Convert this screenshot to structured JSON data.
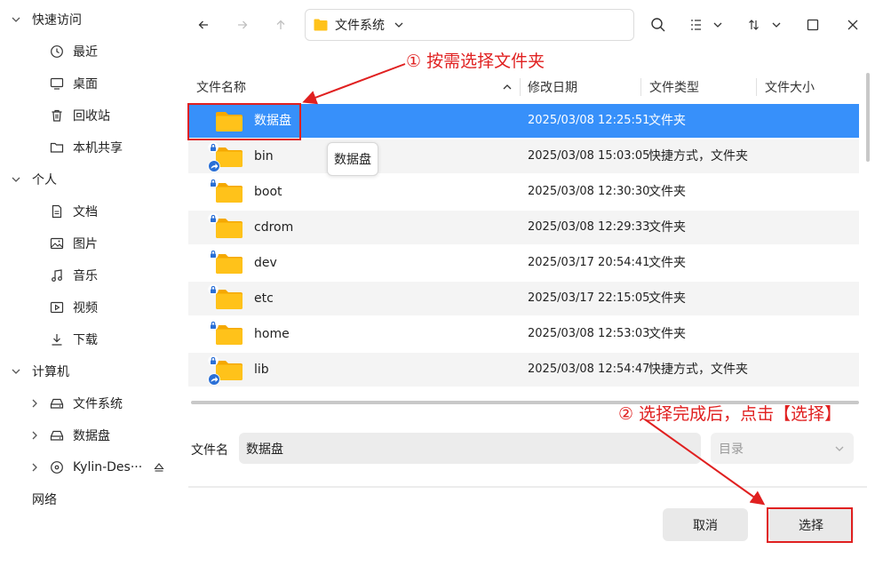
{
  "sidebar": {
    "groups": [
      {
        "label": "快速访问",
        "items": [
          {
            "label": "最近",
            "icon": "clock-icon"
          },
          {
            "label": "桌面",
            "icon": "monitor-icon"
          },
          {
            "label": "回收站",
            "icon": "trash-icon"
          },
          {
            "label": "本机共享",
            "icon": "folder-share-icon"
          }
        ]
      },
      {
        "label": "个人",
        "items": [
          {
            "label": "文档",
            "icon": "document-icon"
          },
          {
            "label": "图片",
            "icon": "picture-icon"
          },
          {
            "label": "音乐",
            "icon": "music-icon"
          },
          {
            "label": "视频",
            "icon": "video-icon"
          },
          {
            "label": "下载",
            "icon": "download-icon"
          }
        ]
      },
      {
        "label": "计算机",
        "items": [
          {
            "label": "文件系统",
            "icon": "drive-icon"
          },
          {
            "label": "数据盘",
            "icon": "drive-icon"
          },
          {
            "label": "Kylin-Des···",
            "icon": "disc-icon"
          }
        ]
      },
      {
        "label": "网络",
        "items": []
      }
    ]
  },
  "toolbar": {
    "path_label": "文件系统"
  },
  "columns": {
    "name": "文件名称",
    "modified": "修改日期",
    "type": "文件类型",
    "size": "文件大小"
  },
  "files": [
    {
      "name": "数据盘",
      "date": "2025/03/08 12:25:51",
      "type": "文件夹",
      "lock": false,
      "link": false,
      "selected": true
    },
    {
      "name": "bin",
      "date": "2025/03/08 15:03:05",
      "type": "快捷方式，文件夹",
      "lock": true,
      "link": true,
      "selected": false
    },
    {
      "name": "boot",
      "date": "2025/03/08 12:30:30",
      "type": "文件夹",
      "lock": true,
      "link": false,
      "selected": false
    },
    {
      "name": "cdrom",
      "date": "2025/03/08 12:29:33",
      "type": "文件夹",
      "lock": true,
      "link": false,
      "selected": false
    },
    {
      "name": "dev",
      "date": "2025/03/17 20:54:41",
      "type": "文件夹",
      "lock": true,
      "link": false,
      "selected": false
    },
    {
      "name": "etc",
      "date": "2025/03/17 22:15:05",
      "type": "文件夹",
      "lock": true,
      "link": false,
      "selected": false
    },
    {
      "name": "home",
      "date": "2025/03/08 12:53:03",
      "type": "文件夹",
      "lock": true,
      "link": false,
      "selected": false
    },
    {
      "name": "lib",
      "date": "2025/03/08 12:54:47",
      "type": "快捷方式，文件夹",
      "lock": true,
      "link": true,
      "selected": false
    }
  ],
  "tooltip": "数据盘",
  "filename": {
    "label": "文件名",
    "value": "数据盘"
  },
  "type_select": {
    "value": "目录"
  },
  "buttons": {
    "cancel": "取消",
    "select": "选择"
  },
  "annotations": {
    "step1": "① 按需选择文件夹",
    "step2": "② 选择完成后，点击【选择】"
  },
  "colors": {
    "selection": "#3790fa",
    "annotation": "#e02020",
    "folder": "#ffc21a"
  }
}
